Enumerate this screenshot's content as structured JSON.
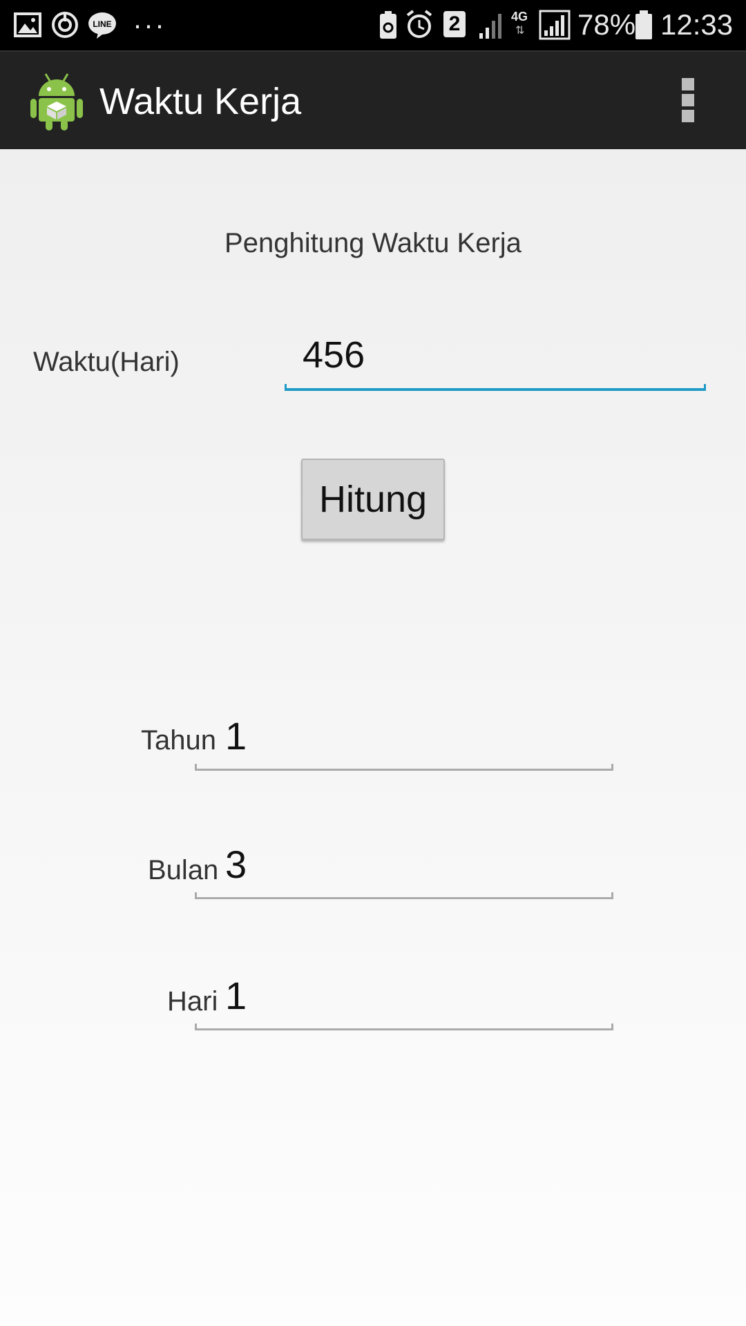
{
  "status_bar": {
    "battery_percent": "78%",
    "time": "12:33",
    "sim_badge": "2",
    "network_type": "4G",
    "overflow_dots": "···",
    "line_app_label": "LINE"
  },
  "action_bar": {
    "title": "Waktu Kerja"
  },
  "main": {
    "heading": "Penghitung Waktu Kerja",
    "waktu_label": "Waktu(Hari)",
    "waktu_value": "456",
    "button_label": "Hitung",
    "results": [
      {
        "label": "Tahun",
        "value": "1"
      },
      {
        "label": "Bulan",
        "value": "3"
      },
      {
        "label": "Hari",
        "value": "1"
      }
    ]
  },
  "colors": {
    "accent": "#1e9bc7",
    "action_bar": "#222222",
    "android_green": "#8bc34a"
  }
}
